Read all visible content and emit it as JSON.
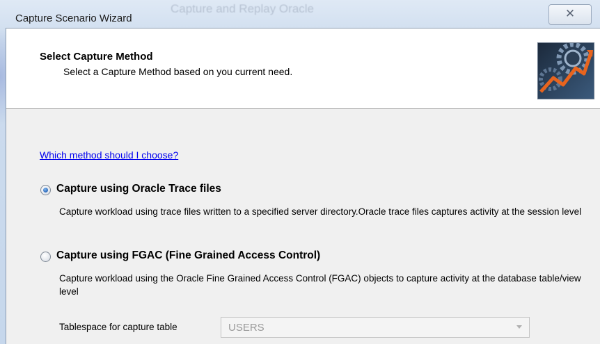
{
  "window": {
    "title": "Capture Scenario Wizard",
    "background_title": "Capture and Replay Oracle",
    "close_glyph": "✕"
  },
  "header": {
    "title": "Select Capture Method",
    "subtitle": "Select a Capture Method based on you current need.",
    "logo_icon": "gear-chart-icon"
  },
  "help_link": "Which method should I choose?",
  "options": [
    {
      "label": "Capture using Oracle Trace files",
      "description": "Capture workload using trace files written to a specified server directory.Oracle trace files captures activity at the session level",
      "selected": true
    },
    {
      "label": "Capture using FGAC (Fine Grained Access Control)",
      "description": "Capture workload using the Oracle Fine Grained Access Control (FGAC) objects to capture activity at the database table/view level",
      "selected": false
    }
  ],
  "tablespace": {
    "label": "Tablespace for capture table",
    "value": "USERS",
    "enabled": false
  },
  "colors": {
    "link": "#0000ee",
    "radio_selected": "#2c68b8",
    "disabled_text": "#9a9a9a"
  }
}
